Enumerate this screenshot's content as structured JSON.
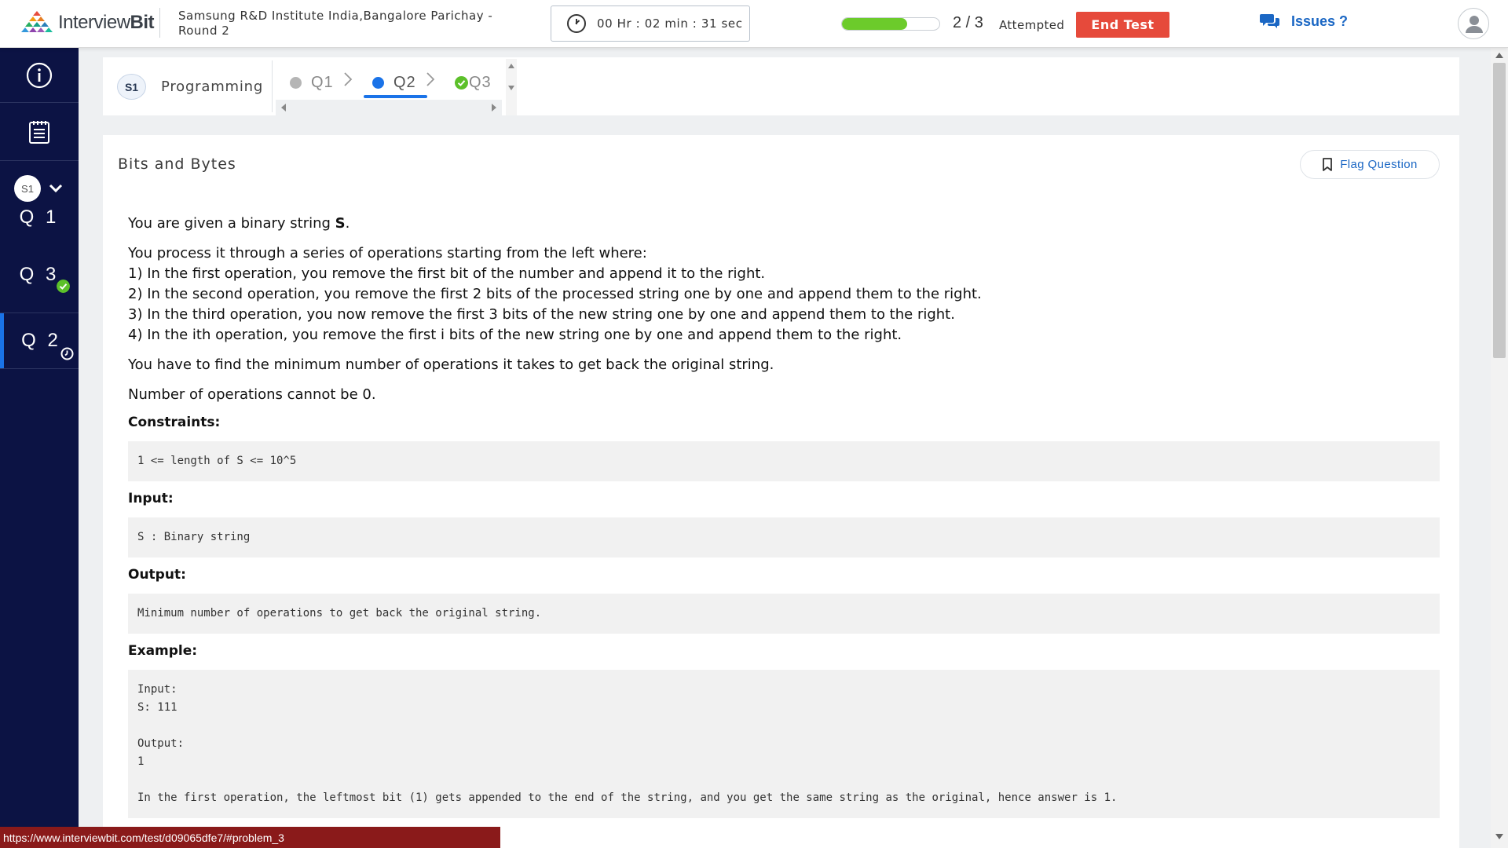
{
  "header": {
    "logo_text_light": "Interview",
    "logo_text_bold": "Bit",
    "test_title": "Samsung R&D Institute India,Bangalore Parichay - Round 2",
    "timer": "00 Hr : 02 min : 31 sec",
    "progress_fraction": 0.67,
    "progress_count": "2 / 3",
    "progress_label": "Attempted",
    "end_test_label": "End Test",
    "issues_label": "Issues ?"
  },
  "sidebar": {
    "info_icon": "info-icon",
    "list_icon": "list-icon",
    "section_chip": "S1",
    "questions": [
      {
        "label": "Q 1",
        "status": "none"
      },
      {
        "label": "Q 3",
        "status": "answered"
      },
      {
        "label": "Q 2",
        "status": "current"
      }
    ]
  },
  "tabs": {
    "section_chip": "S1",
    "section_label": "Programming",
    "items": [
      {
        "label": "Q1",
        "status": "unvisited"
      },
      {
        "label": "Q2",
        "status": "current"
      },
      {
        "label": "Q3",
        "status": "answered"
      }
    ]
  },
  "question": {
    "title": "Bits and Bytes",
    "flag_label": "Flag Question",
    "intro_prefix": "You are given a binary string ",
    "intro_var": "S",
    "intro_suffix": ".",
    "process_intro": "You process it through a series of operations starting from the left where:",
    "operations": [
      "1) In the first operation, you remove the first bit of the number and append it to the right.",
      "2) In the second operation, you remove the first 2 bits of the processed string one by one and append them to the right.",
      "3) In the third operation, you now remove the first 3 bits of the new string one by one and append them to the right.",
      "4) In the ith operation, you remove the first i bits of the new string one by one and append them to the right."
    ],
    "task": "You have to find the minimum number of operations it takes to get back the original string.",
    "note": "Number of operations cannot be 0.",
    "constraints_heading": "Constraints:",
    "constraints": "1 <= length of S <= 10^5",
    "input_heading": "Input:",
    "input": "S : Binary string",
    "output_heading": "Output:",
    "output": "Minimum number of operations to get back the original string.",
    "example_heading": "Example:",
    "example": "Input:\nS: 111\n\nOutput:\n1\n\nIn the first operation, the leftmost bit (1) gets appended to the end of the string, and you get the same string as the original, hence answer is 1."
  },
  "status_url": "https://www.interviewbit.com/test/d09065dfe7/#problem_3",
  "colors": {
    "sidebar_bg": "#0c1344",
    "accent_blue": "#1a73e8",
    "end_test_red": "#e64a3b",
    "progress_green": "#6ccb2b",
    "answered_green": "#5cc02a"
  }
}
